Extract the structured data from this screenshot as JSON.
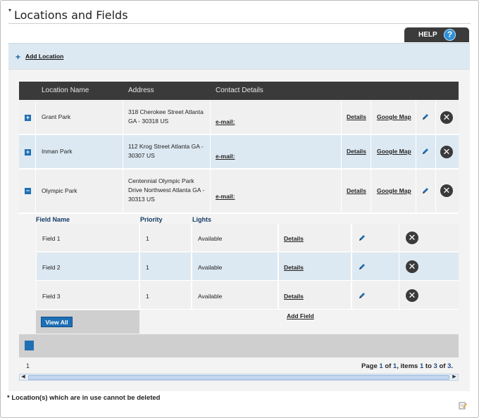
{
  "page": {
    "title": "Locations and Fields"
  },
  "help": {
    "label": "HELP",
    "icon_glyph": "?"
  },
  "toolbar": {
    "add_location_label": "Add Location"
  },
  "table": {
    "columns": [
      "Location Name",
      "Address",
      "Contact Details"
    ],
    "rows": [
      {
        "expander": "+",
        "name": "Grant Park",
        "address_lines": [
          "318 Cherokee Street Atlanta",
          "GA - 30318 US"
        ],
        "contact": "e-mail:",
        "details": "Details",
        "map": "Google Map"
      },
      {
        "expander": "+",
        "name": "Inman Park",
        "address_lines": [
          "112 Krog Street Atlanta GA -",
          "30307 US"
        ],
        "contact": "e-mail:",
        "details": "Details",
        "map": "Google Map"
      },
      {
        "expander": "−",
        "name": "Olympic Park",
        "address_lines": [
          "Centennial Olympic Park",
          "Drive Northwest Atlanta GA -",
          "30313 US"
        ],
        "contact": "e-mail:",
        "details": "Details",
        "map": "Google Map"
      }
    ]
  },
  "fields": {
    "columns": [
      "Field Name",
      "Priority",
      "Lights"
    ],
    "rows": [
      {
        "name": "Field 1",
        "priority": "1",
        "lights": "Available",
        "details": "Details"
      },
      {
        "name": "Field 2",
        "priority": "1",
        "lights": "Available",
        "details": "Details"
      },
      {
        "name": "Field 3",
        "priority": "1",
        "lights": "Available",
        "details": "Details"
      }
    ],
    "view_all_label": "View All",
    "add_field_label": "Add Field"
  },
  "paging": {
    "current_page": "1",
    "summary": {
      "prefix": "Page",
      "page": "1",
      "of": "of",
      "total_pages": "1",
      "items": ", items",
      "from": "1",
      "to": "to",
      "end": "3",
      "of2": "of",
      "total_items": "3",
      "suffix": "."
    }
  },
  "footer": {
    "note": "* Location(s) which are in use cannot be deleted"
  },
  "colors": {
    "accent": "#1f6fb5",
    "header": "#3a3a3a",
    "row_alt": "#dde9f2"
  },
  "icons": {
    "expand": "plus-square-icon",
    "collapse": "minus-square-icon",
    "edit": "pencil-icon",
    "delete": "delete-x-icon",
    "help": "question-icon",
    "notes": "notepad-icon"
  }
}
